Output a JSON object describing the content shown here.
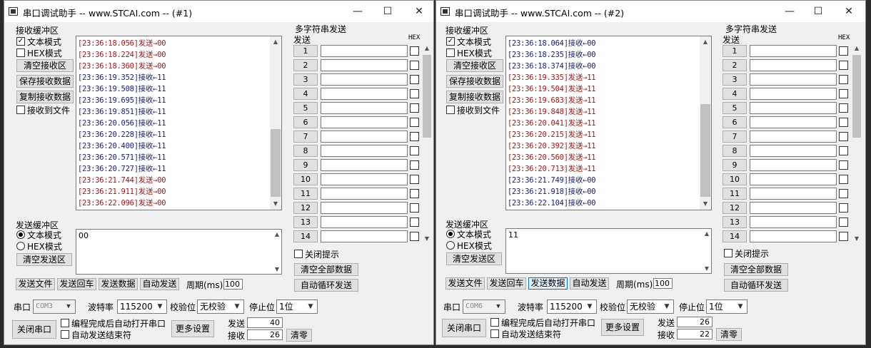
{
  "windows": [
    {
      "title": "串口调试助手 -- www.STCAI.com -- (#1)",
      "recv_section": "接收缓冲区",
      "text_mode": "文本模式",
      "hex_mode": "HEX模式",
      "btn_clear_recv": "清空接收区",
      "btn_save_recv": "保存接收数据",
      "btn_copy_recv": "复制接收数据",
      "recv_to_file": "接收到文件",
      "log": [
        {
          "text": "[23:36:18.056]发送→00",
          "kind": "sent"
        },
        {
          "text": "[23:36:18.224]发送→00",
          "kind": "sent"
        },
        {
          "text": "[23:36:18.360]发送→00",
          "kind": "sent"
        },
        {
          "text": "[23:36:19.352]接收←11",
          "kind": "recv"
        },
        {
          "text": "[23:36:19.508]接收←11",
          "kind": "recv"
        },
        {
          "text": "[23:36:19.695]接收←11",
          "kind": "recv"
        },
        {
          "text": "[23:36:19.851]接收←11",
          "kind": "recv"
        },
        {
          "text": "[23:36:20.056]接收←11",
          "kind": "recv"
        },
        {
          "text": "[23:36:20.228]接收←11",
          "kind": "recv"
        },
        {
          "text": "[23:36:20.400]接收←11",
          "kind": "recv"
        },
        {
          "text": "[23:36:20.571]接收←11",
          "kind": "recv"
        },
        {
          "text": "[23:36:20.727]接收←11",
          "kind": "recv"
        },
        {
          "text": "[23:36:21.744]发送→00",
          "kind": "sent"
        },
        {
          "text": "[23:36:21.911]发送→00",
          "kind": "sent"
        },
        {
          "text": "[23:36:22.096]发送→00",
          "kind": "sent"
        }
      ],
      "multi_title": "多字符串发送",
      "send_col": "发送",
      "hex_col": "HEX",
      "rows": [
        "1",
        "2",
        "3",
        "4",
        "5",
        "6",
        "7",
        "8",
        "9",
        "10",
        "11",
        "12",
        "13",
        "14"
      ],
      "close_tip": "关闭提示",
      "btn_clear_all": "清空全部数据",
      "btn_auto_loop": "自动循环发送",
      "send_section": "发送缓冲区",
      "send_text": "00",
      "btn_clear_send": "清空发送区",
      "btn_send_file": "发送文件",
      "btn_send_cr": "发送回车",
      "btn_send_data": "发送数据",
      "btn_auto_send": "自动发送",
      "period_label": "周期(ms)",
      "period": "100",
      "port_label": "串口",
      "port": "COM3",
      "baud_label": "波特率",
      "baud": "115200",
      "parity_label": "校验位",
      "parity": "无校验",
      "stop_label": "停止位",
      "stop": "1位",
      "btn_close_port": "关闭串口",
      "auto_open": "编程完成后自动打开串口",
      "auto_send_end": "自动发送结束符",
      "btn_more": "更多设置",
      "sent_label": "发送",
      "sent_count": "40",
      "recv_label": "接收",
      "recv_count": "26",
      "btn_zero": "清零"
    },
    {
      "title": "串口调试助手 -- www.STCAI.com -- (#2)",
      "recv_section": "接收缓冲区",
      "text_mode": "文本模式",
      "hex_mode": "HEX模式",
      "btn_clear_recv": "清空接收区",
      "btn_save_recv": "保存接收数据",
      "btn_copy_recv": "复制接收数据",
      "recv_to_file": "接收到文件",
      "log": [
        {
          "text": "[23:36:18.064]接收←00",
          "kind": "recv"
        },
        {
          "text": "[23:36:18.235]接收←00",
          "kind": "recv"
        },
        {
          "text": "[23:36:18.374]接收←00",
          "kind": "recv"
        },
        {
          "text": "[23:36:19.335]发送→11",
          "kind": "sent"
        },
        {
          "text": "[23:36:19.504]发送→11",
          "kind": "sent"
        },
        {
          "text": "[23:36:19.683]发送→11",
          "kind": "sent"
        },
        {
          "text": "[23:36:19.848]发送→11",
          "kind": "sent"
        },
        {
          "text": "[23:36:20.041]发送→11",
          "kind": "sent"
        },
        {
          "text": "[23:36:20.215]发送→11",
          "kind": "sent"
        },
        {
          "text": "[23:36:20.392]发送→11",
          "kind": "sent"
        },
        {
          "text": "[23:36:20.560]发送→11",
          "kind": "sent"
        },
        {
          "text": "[23:36:20.713]发送→11",
          "kind": "sent"
        },
        {
          "text": "[23:36:21.749]接收←00",
          "kind": "recv"
        },
        {
          "text": "[23:36:21.918]接收←00",
          "kind": "recv"
        },
        {
          "text": "[23:36:22.104]接收←00",
          "kind": "recv"
        }
      ],
      "multi_title": "多字符串发送",
      "send_col": "发送",
      "hex_col": "HEX",
      "rows": [
        "1",
        "2",
        "3",
        "4",
        "5",
        "6",
        "7",
        "8",
        "9",
        "10",
        "11",
        "12",
        "13",
        "14"
      ],
      "close_tip": "关闭提示",
      "btn_clear_all": "清空全部数据",
      "btn_auto_loop": "自动循环发送",
      "send_section": "发送缓冲区",
      "send_text": "11",
      "btn_clear_send": "清空发送区",
      "btn_send_file": "发送文件",
      "btn_send_cr": "发送回车",
      "btn_send_data": "发送数据",
      "btn_auto_send": "自动发送",
      "period_label": "周期(ms)",
      "period": "100",
      "port_label": "串口",
      "port": "COM6",
      "baud_label": "波特率",
      "baud": "115200",
      "parity_label": "校验位",
      "parity": "无校验",
      "stop_label": "停止位",
      "stop": "1位",
      "btn_close_port": "关闭串口",
      "auto_open": "编程完成后自动打开串口",
      "auto_send_end": "自动发送结束符",
      "btn_more": "更多设置",
      "sent_label": "发送",
      "sent_count": "26",
      "recv_label": "接收",
      "recv_count": "22",
      "btn_zero": "清零"
    }
  ]
}
